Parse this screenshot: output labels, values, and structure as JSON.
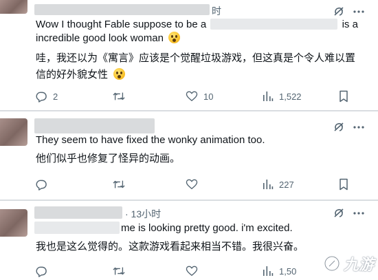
{
  "posts": [
    {
      "header_suffix": "时",
      "body_en": "Wow I thought Fable suppose to be a",
      "body_en_tail": "is a",
      "body_en_line2": "incredible good look woman",
      "body_zh": "哇，我还以为《寓言》应该是个觉醒垃圾游戏，但这真是个令人难以置信的好外貌女性",
      "reply_count": "2",
      "repost_count": "",
      "like_count": "10",
      "views_count": "1,522"
    },
    {
      "header_suffix": "",
      "body_en": "They seem to have fixed the wonky animation too.",
      "body_zh": "他们似乎也修复了怪异的动画。",
      "reply_count": "",
      "repost_count": "",
      "like_count": "",
      "views_count": "227"
    },
    {
      "header_suffix": "· 13小时",
      "body_en": "me is looking pretty good. i'm excited.",
      "body_zh": "我也是这么觉得的。这款游戏看起来相当不错。我很兴奋。",
      "reply_count": "",
      "repost_count": "",
      "like_count": "",
      "views_count": "1,50"
    }
  ],
  "icons": {
    "grok": "grok-slash-icon",
    "more": "more-dots-icon",
    "reply": "reply-bubble-icon",
    "repost": "repost-arrows-icon",
    "like": "heart-icon",
    "views": "views-bars-icon",
    "emoji": "astonished-face-emoji"
  },
  "watermark": {
    "text": "九游"
  },
  "colors": {
    "text": "#0f1419",
    "muted": "#536471",
    "separator": "#d9dde1",
    "blur": "#d9dbdd"
  }
}
